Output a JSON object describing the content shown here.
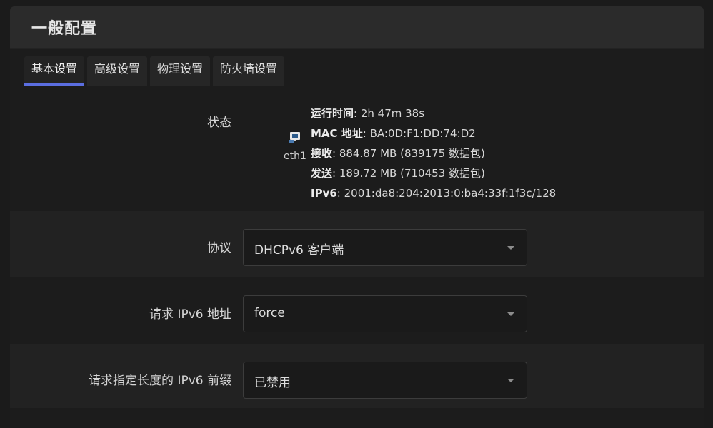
{
  "panel": {
    "title": "一般配置"
  },
  "tabs": [
    {
      "label": "基本设置",
      "active": true
    },
    {
      "label": "高级设置",
      "active": false
    },
    {
      "label": "物理设置",
      "active": false
    },
    {
      "label": "防火墙设置",
      "active": false
    }
  ],
  "status": {
    "label": "状态",
    "interface": {
      "name": "eth1",
      "icon": "network-port-icon"
    },
    "lines": [
      {
        "key": "运行时间",
        "value": "2h 47m 38s"
      },
      {
        "key": "MAC 地址",
        "value": "BA:0D:F1:DD:74:D2"
      },
      {
        "key": "接收",
        "value": "884.87 MB (839175 数据包)"
      },
      {
        "key": "发送",
        "value": "189.72 MB (710453 数据包)"
      },
      {
        "key": "IPv6",
        "value": "2001:da8:204:2013:0:ba4:33f:1f3c/128"
      }
    ]
  },
  "fields": {
    "protocol": {
      "label": "协议",
      "value": "DHCPv6 客户端"
    },
    "request_ipv6": {
      "label": "请求 IPv6 地址",
      "value": "force"
    },
    "prefix_length": {
      "label": "请求指定长度的 IPv6 前缀",
      "value": "已禁用"
    }
  },
  "colors": {
    "accent": "#5b6ee0",
    "header_bg": "#2b2b2b",
    "page_bg": "#1b1b1b"
  }
}
